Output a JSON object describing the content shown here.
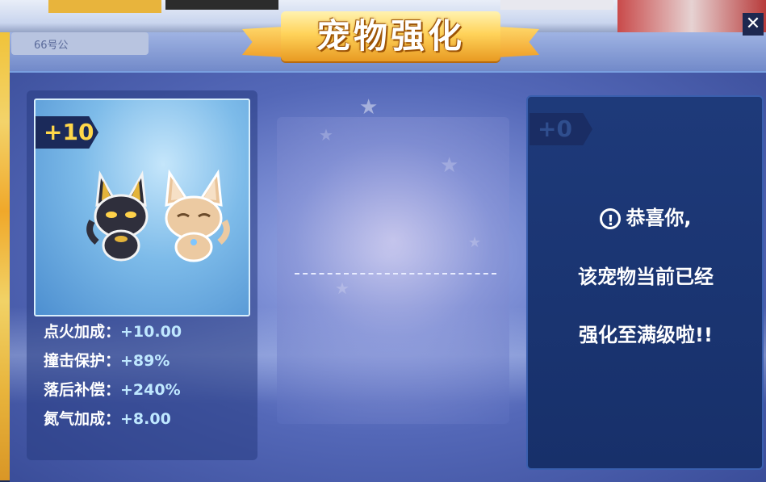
{
  "title": "宠物强化",
  "background": {
    "tab_label": "66号公"
  },
  "close_label": "✕",
  "pet": {
    "level": "+10",
    "stats": [
      {
        "label": "点火加成：",
        "value": "+10.00"
      },
      {
        "label": "撞击保护：",
        "value": "+89%"
      },
      {
        "label": "落后补偿：",
        "value": "+240%"
      },
      {
        "label": "氮气加成：",
        "value": "+8.00"
      }
    ]
  },
  "result": {
    "level": "+0",
    "warn_icon": "!",
    "line1": "恭喜你,",
    "line2": "该宠物当前已经",
    "line3": "强化至满级啦!!"
  },
  "colors": {
    "title_gold": "#ffd35a",
    "level_yellow": "#ffd74a",
    "stat_value": "#bfe8ff",
    "panel_dark": "#17306a"
  }
}
